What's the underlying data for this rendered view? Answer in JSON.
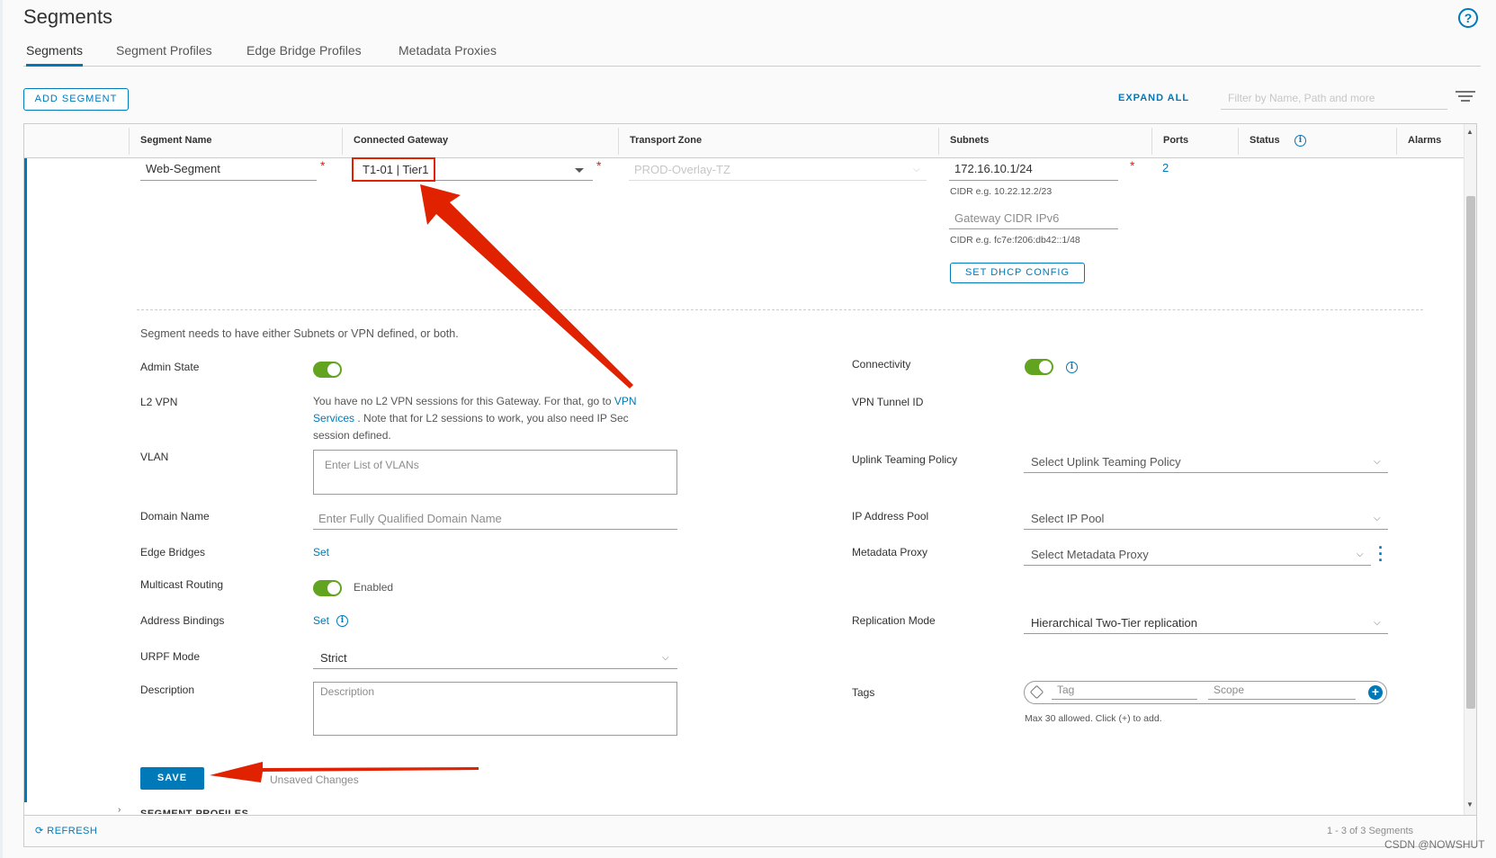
{
  "page": {
    "title": "Segments",
    "help_icon": "question-circle-icon"
  },
  "tabs": [
    {
      "label": "Segments",
      "active": true
    },
    {
      "label": "Segment Profiles",
      "active": false
    },
    {
      "label": "Edge Bridge Profiles",
      "active": false
    },
    {
      "label": "Metadata Proxies",
      "active": false
    }
  ],
  "toolbar": {
    "add_segment_label": "ADD SEGMENT",
    "expand_all_label": "EXPAND ALL",
    "filter_placeholder": "Filter by Name, Path and more"
  },
  "grid": {
    "columns": [
      "Segment Name",
      "Connected Gateway",
      "Transport Zone",
      "Subnets",
      "Ports",
      "Status",
      "Alarms"
    ]
  },
  "segment": {
    "name": "Web-Segment",
    "gateway": "T1-01 | Tier1",
    "transport_zone": "PROD-Overlay-TZ",
    "subnet": "172.16.10.1/24",
    "subnet_hint": "CIDR e.g. 10.22.12.2/23",
    "ipv6_placeholder": "Gateway CIDR IPv6",
    "ipv6_hint": "CIDR e.g. fc7e:f206:db42::1/48",
    "dhcp_button": "SET DHCP CONFIG",
    "ports": "2",
    "required_mark": "*"
  },
  "details": {
    "notice": "Segment needs to have either Subnets or VPN defined, or both.",
    "admin_state_label": "Admin State",
    "l2vpn_label": "L2 VPN",
    "l2vpn_text_1": "You have no L2 VPN sessions for this Gateway. For that, go to",
    "l2vpn_link_1": "VPN",
    "l2vpn_link_2": "Services",
    "l2vpn_text_2": ". Note that for L2 sessions to work, you also need IP Sec",
    "l2vpn_text_3": "session defined.",
    "vlan_label": "VLAN",
    "vlan_placeholder": "Enter List of VLANs",
    "domain_label": "Domain Name",
    "domain_placeholder": "Enter Fully Qualified Domain Name",
    "edge_bridges_label": "Edge Bridges",
    "edge_bridges_link": "Set",
    "multicast_label": "Multicast Routing",
    "multicast_value": "Enabled",
    "address_bindings_label": "Address Bindings",
    "address_bindings_link": "Set",
    "urpf_label": "URPF Mode",
    "urpf_value": "Strict",
    "description_label": "Description",
    "description_placeholder": "Description",
    "connectivity_label": "Connectivity",
    "vpn_tunnel_label": "VPN Tunnel ID",
    "uplink_label": "Uplink Teaming Policy",
    "uplink_placeholder": "Select Uplink Teaming Policy",
    "ip_pool_label": "IP Address Pool",
    "ip_pool_placeholder": "Select IP Pool",
    "metadata_label": "Metadata Proxy",
    "metadata_placeholder": "Select Metadata Proxy",
    "replication_label": "Replication Mode",
    "replication_value": "Hierarchical Two-Tier replication",
    "tags_label": "Tags",
    "tag_placeholder": "Tag",
    "scope_placeholder": "Scope",
    "tags_hint": "Max 30 allowed. Click (+) to add.",
    "save_label": "SAVE",
    "unsaved_text": "Unsaved Changes",
    "profiles_section": "SEGMENT PROFILES"
  },
  "footer": {
    "refresh_label": "REFRESH",
    "pager_text": "1 - 3 of 3 Segments",
    "watermark": "CSDN @NOWSHUT"
  },
  "colors": {
    "accent": "#0079b8",
    "toggle_on": "#62a420",
    "annotation": "#e12200"
  }
}
